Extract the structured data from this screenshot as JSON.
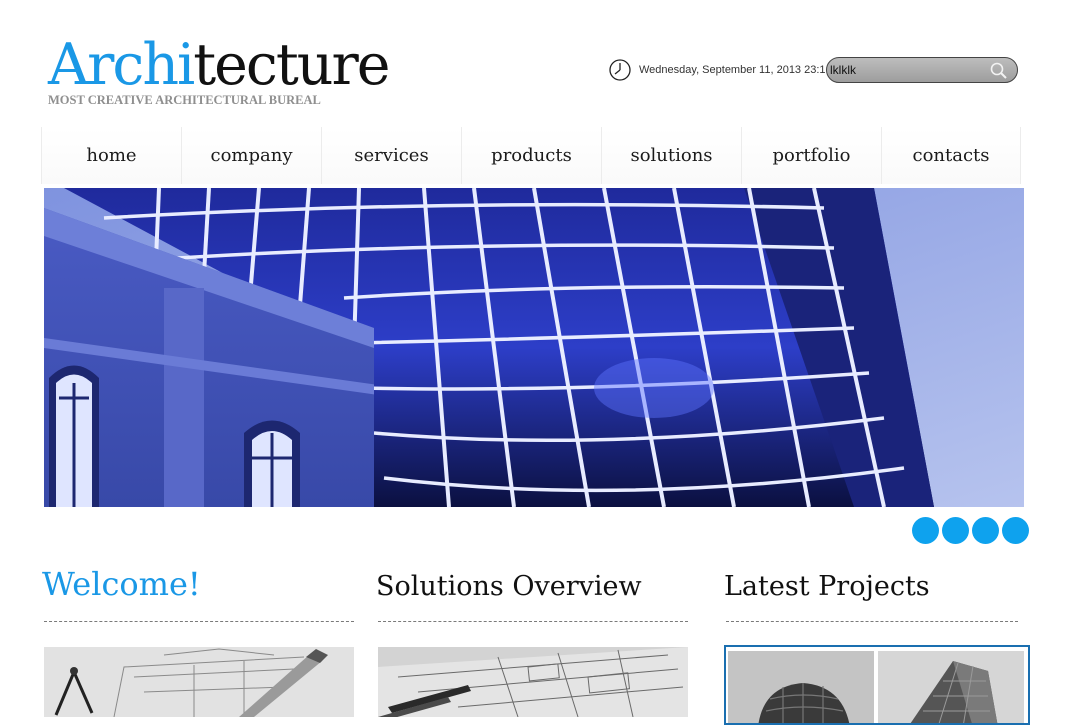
{
  "logo": {
    "part1": "Archi",
    "part2": "tecture",
    "tagline": "MOST CREATIVE ARCHITECTURAL BUREAL"
  },
  "header": {
    "datetime": "Wednesday, September 11, 2013 23:1",
    "search_value": "lklklk"
  },
  "nav": {
    "items": [
      {
        "label": "home"
      },
      {
        "label": "company"
      },
      {
        "label": "services"
      },
      {
        "label": "products"
      },
      {
        "label": "solutions"
      },
      {
        "label": "portfolio"
      },
      {
        "label": "contacts"
      }
    ]
  },
  "slider": {
    "dot_count": 4
  },
  "sections": {
    "welcome": {
      "title": "Welcome!"
    },
    "solutions": {
      "title": "Solutions Overview"
    },
    "projects": {
      "title": "Latest Projects"
    }
  },
  "colors": {
    "accent": "#1a98e6",
    "dot": "#0ea2ee",
    "frame": "#1a6fb0"
  },
  "icons": {
    "clock": "clock-icon",
    "search": "search-icon"
  }
}
